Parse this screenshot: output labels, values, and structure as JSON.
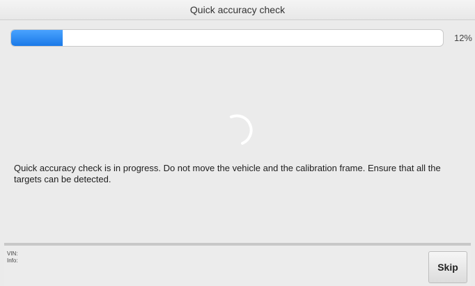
{
  "window": {
    "title": "Quick accuracy check"
  },
  "progress": {
    "value": 0.12,
    "label": "12%",
    "fill_color": "#2a86f0"
  },
  "status": {
    "spinner_icon": "loading-spinner-icon",
    "message": "Quick accuracy check is in progress. Do not move the vehicle and the calibration frame. Ensure that all the targets can be detected."
  },
  "footer": {
    "vin_label": "VIN:",
    "info_label": "Info:",
    "skip_label": "Skip"
  }
}
